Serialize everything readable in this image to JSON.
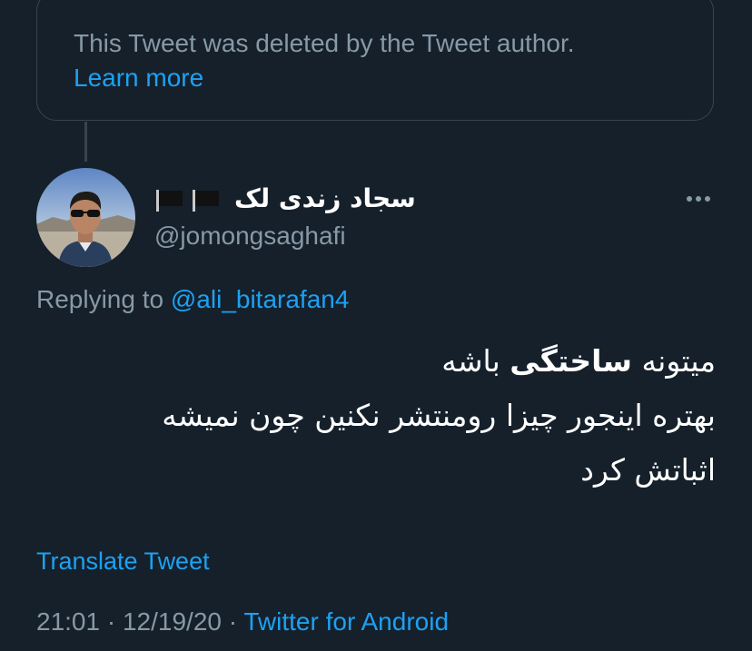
{
  "deleted_notice": {
    "text": "This Tweet was deleted by the Tweet author.",
    "learn_more": "Learn more"
  },
  "author": {
    "display_name": "سجاد زندی لک",
    "handle": "@jomongsaghafi",
    "flags": [
      "black-flag-icon",
      "black-flag-icon"
    ]
  },
  "reply": {
    "prefix": "Replying to",
    "mention": "@ali_bitarafan4"
  },
  "tweet": {
    "line1_part1": "میتونه ",
    "line1_bold": "ساختگی",
    "line1_part2": " باشه",
    "line2": "بهتره اینجور چیزا رومنتشر نکنین چون نمیشه",
    "line3": "اثباتش کرد"
  },
  "translate_label": "Translate Tweet",
  "meta": {
    "time": "21:01",
    "separator": "·",
    "date": "12/19/20",
    "source": "Twitter for Android"
  },
  "colors": {
    "background": "#15202b",
    "border": "#38444d",
    "muted": "#8899a6",
    "link": "#1da1f2",
    "text": "#ffffff"
  }
}
